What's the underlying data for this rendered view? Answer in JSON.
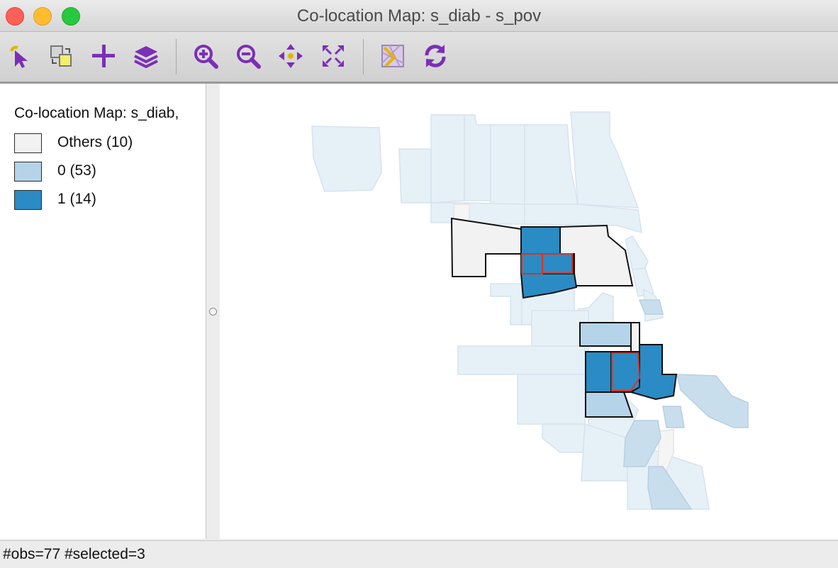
{
  "window": {
    "title": "Co-location Map: s_diab - s_pov"
  },
  "toolbar": {
    "tools": [
      {
        "name": "select-tool",
        "icon": "arrow-pointer-icon"
      },
      {
        "name": "selection-swap-tool",
        "icon": "swap-selection-icon"
      },
      {
        "name": "add-tool",
        "icon": "plus-icon"
      },
      {
        "name": "layers-tool",
        "icon": "layers-icon"
      },
      {
        "name": "zoom-in-tool",
        "icon": "zoom-in-icon"
      },
      {
        "name": "zoom-out-tool",
        "icon": "zoom-out-icon"
      },
      {
        "name": "pan-tool",
        "icon": "pan-arrows-icon"
      },
      {
        "name": "full-extent-tool",
        "icon": "full-extent-icon"
      },
      {
        "name": "basemap-tool",
        "icon": "basemap-icon"
      },
      {
        "name": "refresh-tool",
        "icon": "refresh-icon"
      }
    ],
    "accent_color": "#7b2fb5"
  },
  "legend": {
    "title": "Co-location Map: s_diab,",
    "items": [
      {
        "label": "Others (10)",
        "color": "#f2f2f2"
      },
      {
        "label": "0 (53)",
        "color": "#b5d4e9"
      },
      {
        "label": "1 (14)",
        "color": "#2b8bc4"
      }
    ]
  },
  "map": {
    "selection_outline_color": "#e0301e",
    "background_tract_color": "#e6f0f7"
  },
  "status": {
    "text": "#obs=77 #selected=3"
  }
}
